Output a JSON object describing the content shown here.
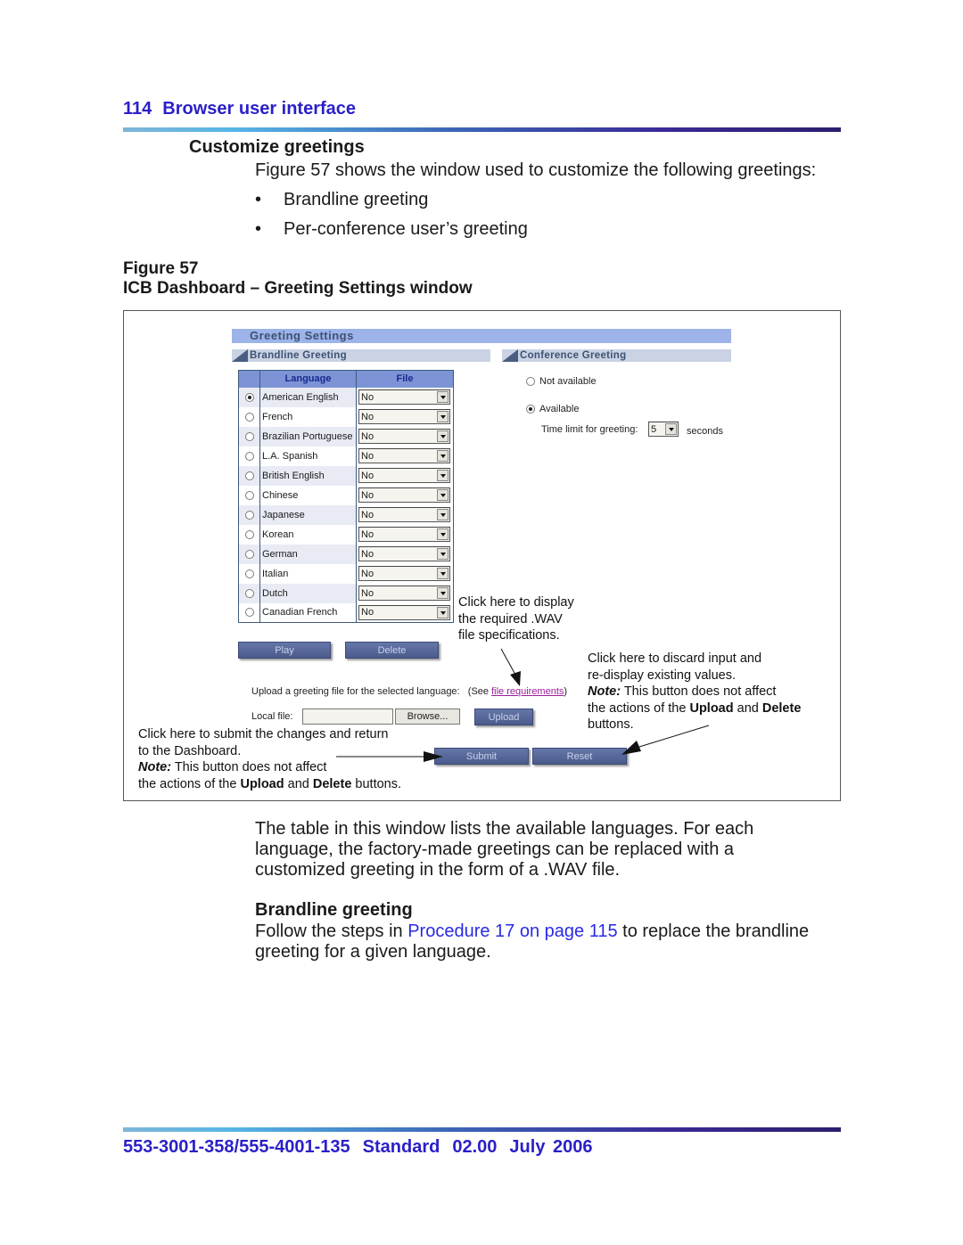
{
  "header": {
    "page_number": "114",
    "section": "Browser user interface"
  },
  "section_heading": "Customize greetings",
  "intro": "Figure 57 shows the window used to customize the following greetings:",
  "bullets": [
    "Brandline greeting",
    "Per-conference user’s greeting"
  ],
  "figure": {
    "number": "Figure 57",
    "caption": "ICB Dashboard – Greeting Settings window"
  },
  "window": {
    "title": "Greeting Settings",
    "brandline_section": "Brandline Greeting",
    "conference_section": "Conference Greeting",
    "table": {
      "columns": [
        "",
        "Language",
        "File"
      ],
      "rows": [
        {
          "language": "American English",
          "file": "No",
          "selected": true
        },
        {
          "language": "French",
          "file": "No",
          "selected": false
        },
        {
          "language": "Brazilian Portuguese",
          "file": "No",
          "selected": false
        },
        {
          "language": "L.A. Spanish",
          "file": "No",
          "selected": false
        },
        {
          "language": "British English",
          "file": "No",
          "selected": false
        },
        {
          "language": "Chinese",
          "file": "No",
          "selected": false
        },
        {
          "language": "Japanese",
          "file": "No",
          "selected": false
        },
        {
          "language": "Korean",
          "file": "No",
          "selected": false
        },
        {
          "language": "German",
          "file": "No",
          "selected": false
        },
        {
          "language": "Italian",
          "file": "No",
          "selected": false
        },
        {
          "language": "Dutch",
          "file": "No",
          "selected": false
        },
        {
          "language": "Canadian French",
          "file": "No",
          "selected": false
        }
      ]
    },
    "buttons": {
      "play": "Play",
      "delete": "Delete",
      "browse": "Browse...",
      "upload": "Upload",
      "submit": "Submit",
      "reset": "Reset"
    },
    "upload_prompt": "Upload a greeting file for the selected language:",
    "see_prefix": "(See ",
    "file_requirements_link": "file requirements",
    "see_suffix": ")",
    "local_file_label": "Local file:",
    "local_file_value": "",
    "conference": {
      "not_available": "Not available",
      "available": "Available",
      "selected": "Available",
      "time_limit_label": "Time limit for greeting:",
      "time_limit_value": "5",
      "seconds_label": "seconds"
    }
  },
  "callouts": {
    "wav": [
      "Click here to display",
      "the required .WAV",
      "file specifications."
    ],
    "reset": {
      "line1": "Click here to discard input and",
      "line2": "re-display existing values.",
      "note_label": "Note:",
      "note_text": " This button does not affect",
      "line4_a": "the actions of the ",
      "upload": "Upload",
      "and": " and ",
      "delete": "Delete",
      "line5": "buttons."
    },
    "submit": {
      "line1": "Click here to submit the changes and return",
      "line2": "to the Dashboard.",
      "note_label": "Note:",
      "note_text": " This button does not affect",
      "line4_a": "the actions of the ",
      "upload": "Upload",
      "and": " and ",
      "delete": "Delete",
      "line4_b": " buttons."
    }
  },
  "paragraph": "The table in this window lists the available languages. For each language, the factory-made greetings can be replaced with a customized greeting in the form of a .WAV file.",
  "brandline": {
    "heading": "Brandline greeting",
    "text_before": "Follow the steps in ",
    "xref": "Procedure 17 on page 115",
    "text_after": " to replace the brandline greeting for a given language."
  },
  "footer": {
    "doc_number": "553-3001-358/555-4001-135",
    "status": "Standard",
    "version": "02.00",
    "date": "July 2006"
  }
}
